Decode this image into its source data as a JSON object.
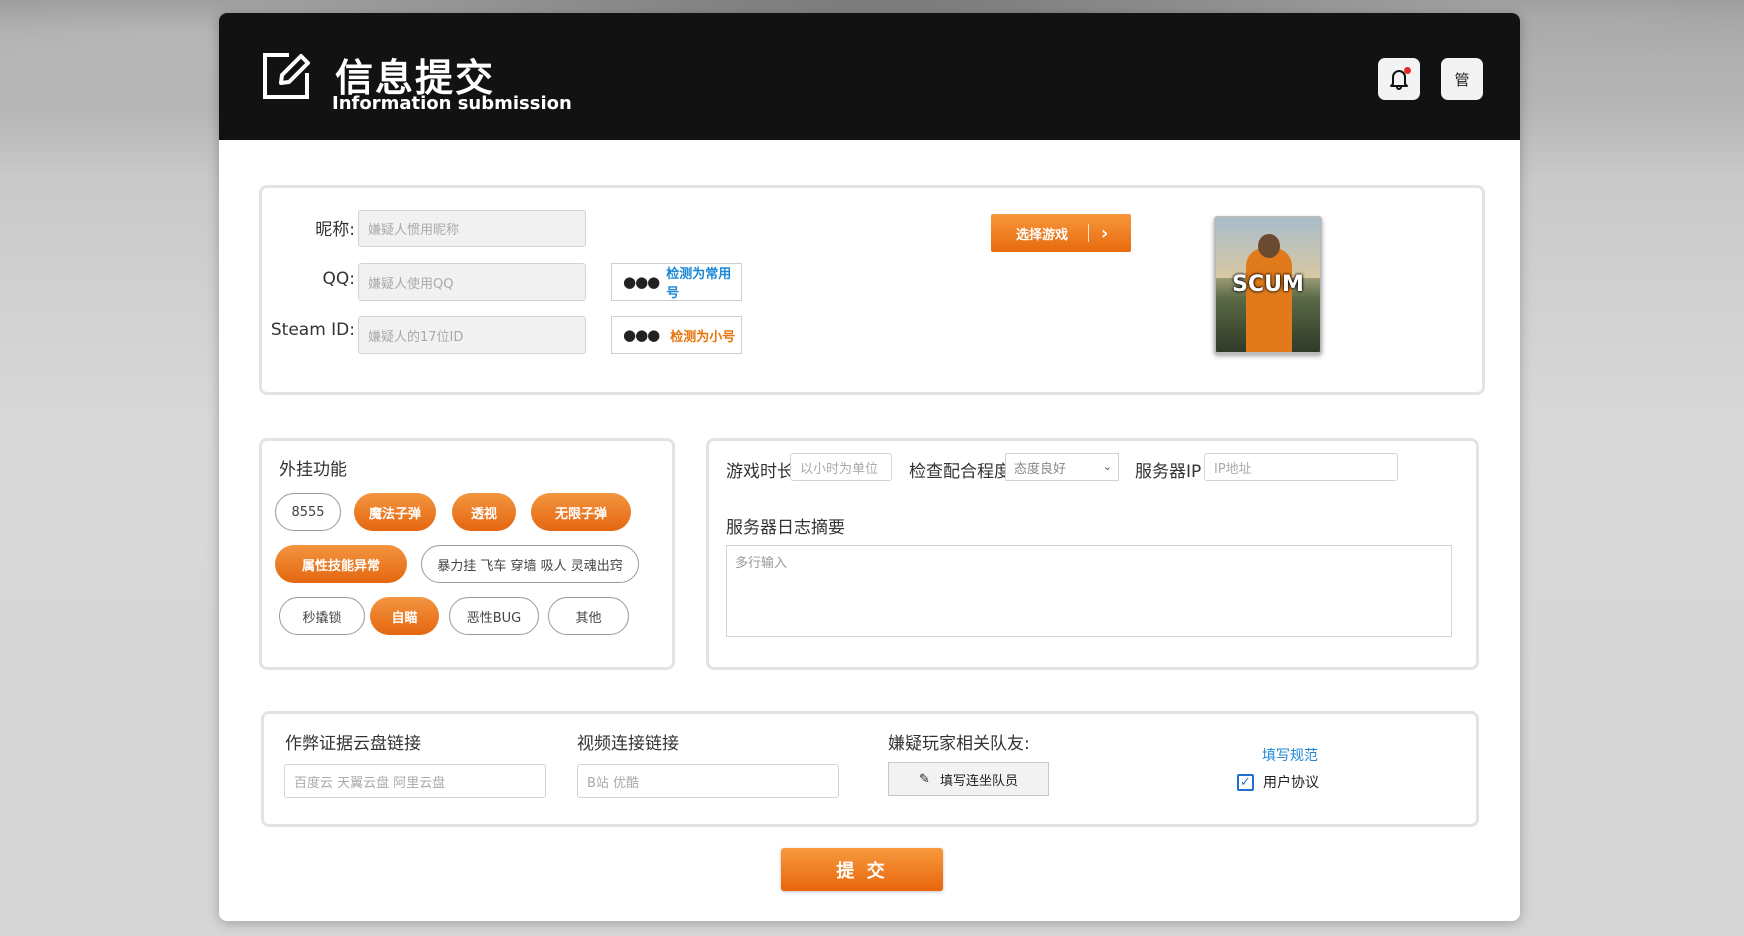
{
  "header": {
    "title_cn": "信息提交",
    "title_en": "Information  submission",
    "notification_icon": "bell-icon",
    "manage_label": "管"
  },
  "suspect": {
    "nickname_label": "昵称:",
    "nickname_placeholder": "嫌疑人惯用昵称",
    "qq_label": "QQ:",
    "qq_placeholder": "嫌疑人使用QQ",
    "steam_label": "Steam ID:",
    "steam_placeholder": "嫌疑人的17位ID",
    "qq_check": "检测为常用号",
    "steam_check": "检测为小号",
    "select_game": "选择游戏",
    "game_cover_text": "SCUM"
  },
  "cheats": {
    "title": "外挂功能",
    "row1": [
      {
        "label": "8555",
        "selected": false
      },
      {
        "label": "魔法子弹",
        "selected": true
      },
      {
        "label": "透视",
        "selected": true
      },
      {
        "label": "无限子弹",
        "selected": true
      }
    ],
    "row2": [
      {
        "label": "属性技能异常",
        "selected": true
      },
      {
        "label": "暴力挂 飞车 穿墙 吸人 灵魂出窍",
        "selected": false
      }
    ],
    "row3": [
      {
        "label": "秒撬锁",
        "selected": false
      },
      {
        "label": "自瞄",
        "selected": true
      },
      {
        "label": "恶性BUG",
        "selected": false
      },
      {
        "label": "其他",
        "selected": false
      }
    ]
  },
  "server": {
    "playtime_label": "游戏时长",
    "playtime_placeholder": "以小时为单位",
    "cooperation_label": "检查配合程度",
    "cooperation_value": "态度良好",
    "ip_label": "服务器IP",
    "ip_placeholder": "IP地址",
    "log_label": "服务器日志摘要",
    "log_placeholder": "多行输入"
  },
  "evidence": {
    "cloud_label": "作弊证据云盘链接",
    "cloud_placeholder": "百度云 天翼云盘 阿里云盘",
    "video_label": "视频连接链接",
    "video_placeholder": "B站 优酷",
    "team_label": "嫌疑玩家相关队友:",
    "team_button": "填写连坐队员",
    "rules_link": "填写规范",
    "agreement_label": "用户协议",
    "agreement_checked": true
  },
  "submit_label": "提 交",
  "colors": {
    "accent_orange": "#e8740c",
    "link_blue": "#1e88d7",
    "header_bg": "#121212"
  }
}
